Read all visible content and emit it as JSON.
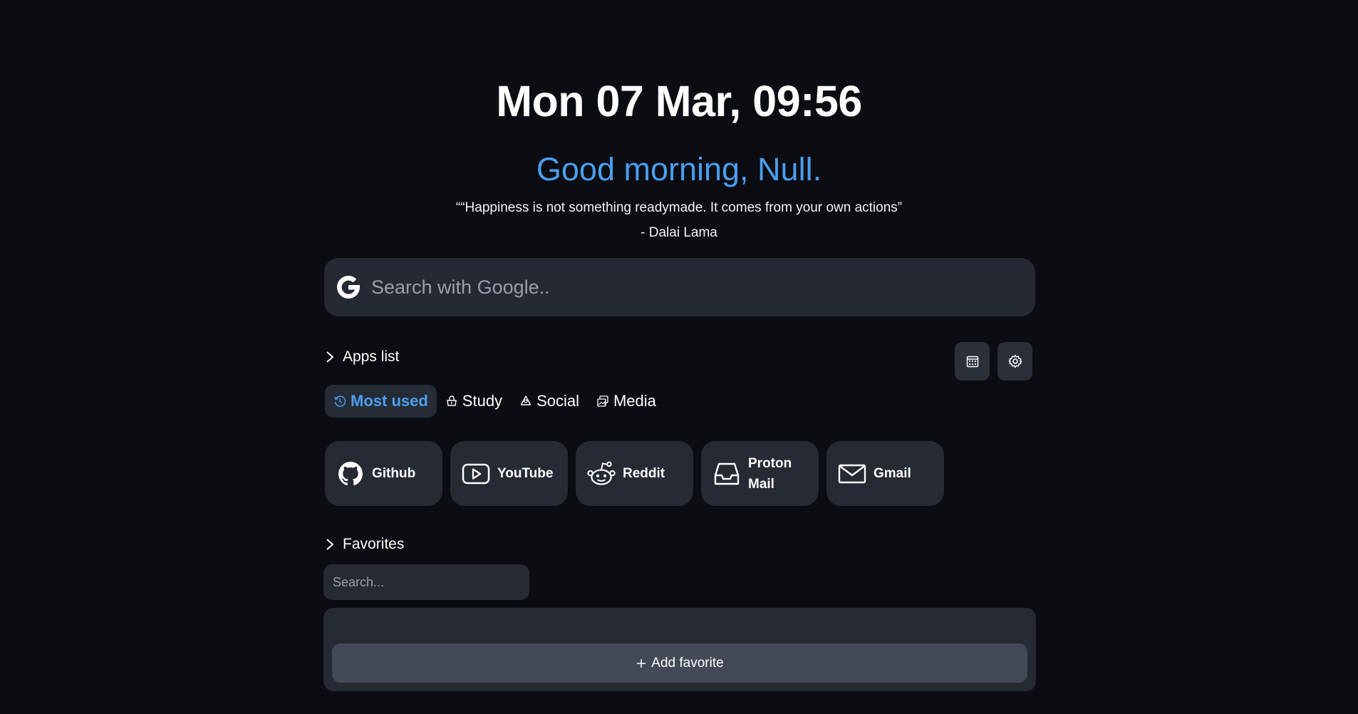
{
  "header": {
    "clock": "Mon 07 Mar, 09:56",
    "greeting": "Good morning, Null.",
    "quote": "““Happiness is not something readymade. It comes from your own actions”",
    "author": "- Dalai Lama"
  },
  "search": {
    "placeholder": "Search with Google..",
    "icon": "google-icon"
  },
  "apps_section": {
    "title": "Apps list",
    "tabs": [
      {
        "label": "Most used",
        "icon": "history-icon",
        "active": true
      },
      {
        "label": "Study",
        "icon": "study-icon",
        "active": false
      },
      {
        "label": "Social",
        "icon": "social-icon",
        "active": false
      },
      {
        "label": "Media",
        "icon": "media-icon",
        "active": false
      }
    ],
    "apps": [
      {
        "label": "Github",
        "icon": "github-icon"
      },
      {
        "label": "YouTube",
        "icon": "youtube-icon"
      },
      {
        "label": "Reddit",
        "icon": "reddit-icon"
      },
      {
        "label": "Proton Mail",
        "icon": "inbox-icon"
      },
      {
        "label": "Gmail",
        "icon": "mail-icon"
      }
    ]
  },
  "toolbar": {
    "calendar_icon": "calendar-icon",
    "settings_icon": "gear-icon"
  },
  "favorites_section": {
    "title": "Favorites",
    "search_placeholder": "Search...",
    "add_label": "Add favorite"
  },
  "colors": {
    "background": "#0b0d12",
    "accent": "#4a9ef0",
    "card": "#252a33",
    "button": "#434a57"
  }
}
